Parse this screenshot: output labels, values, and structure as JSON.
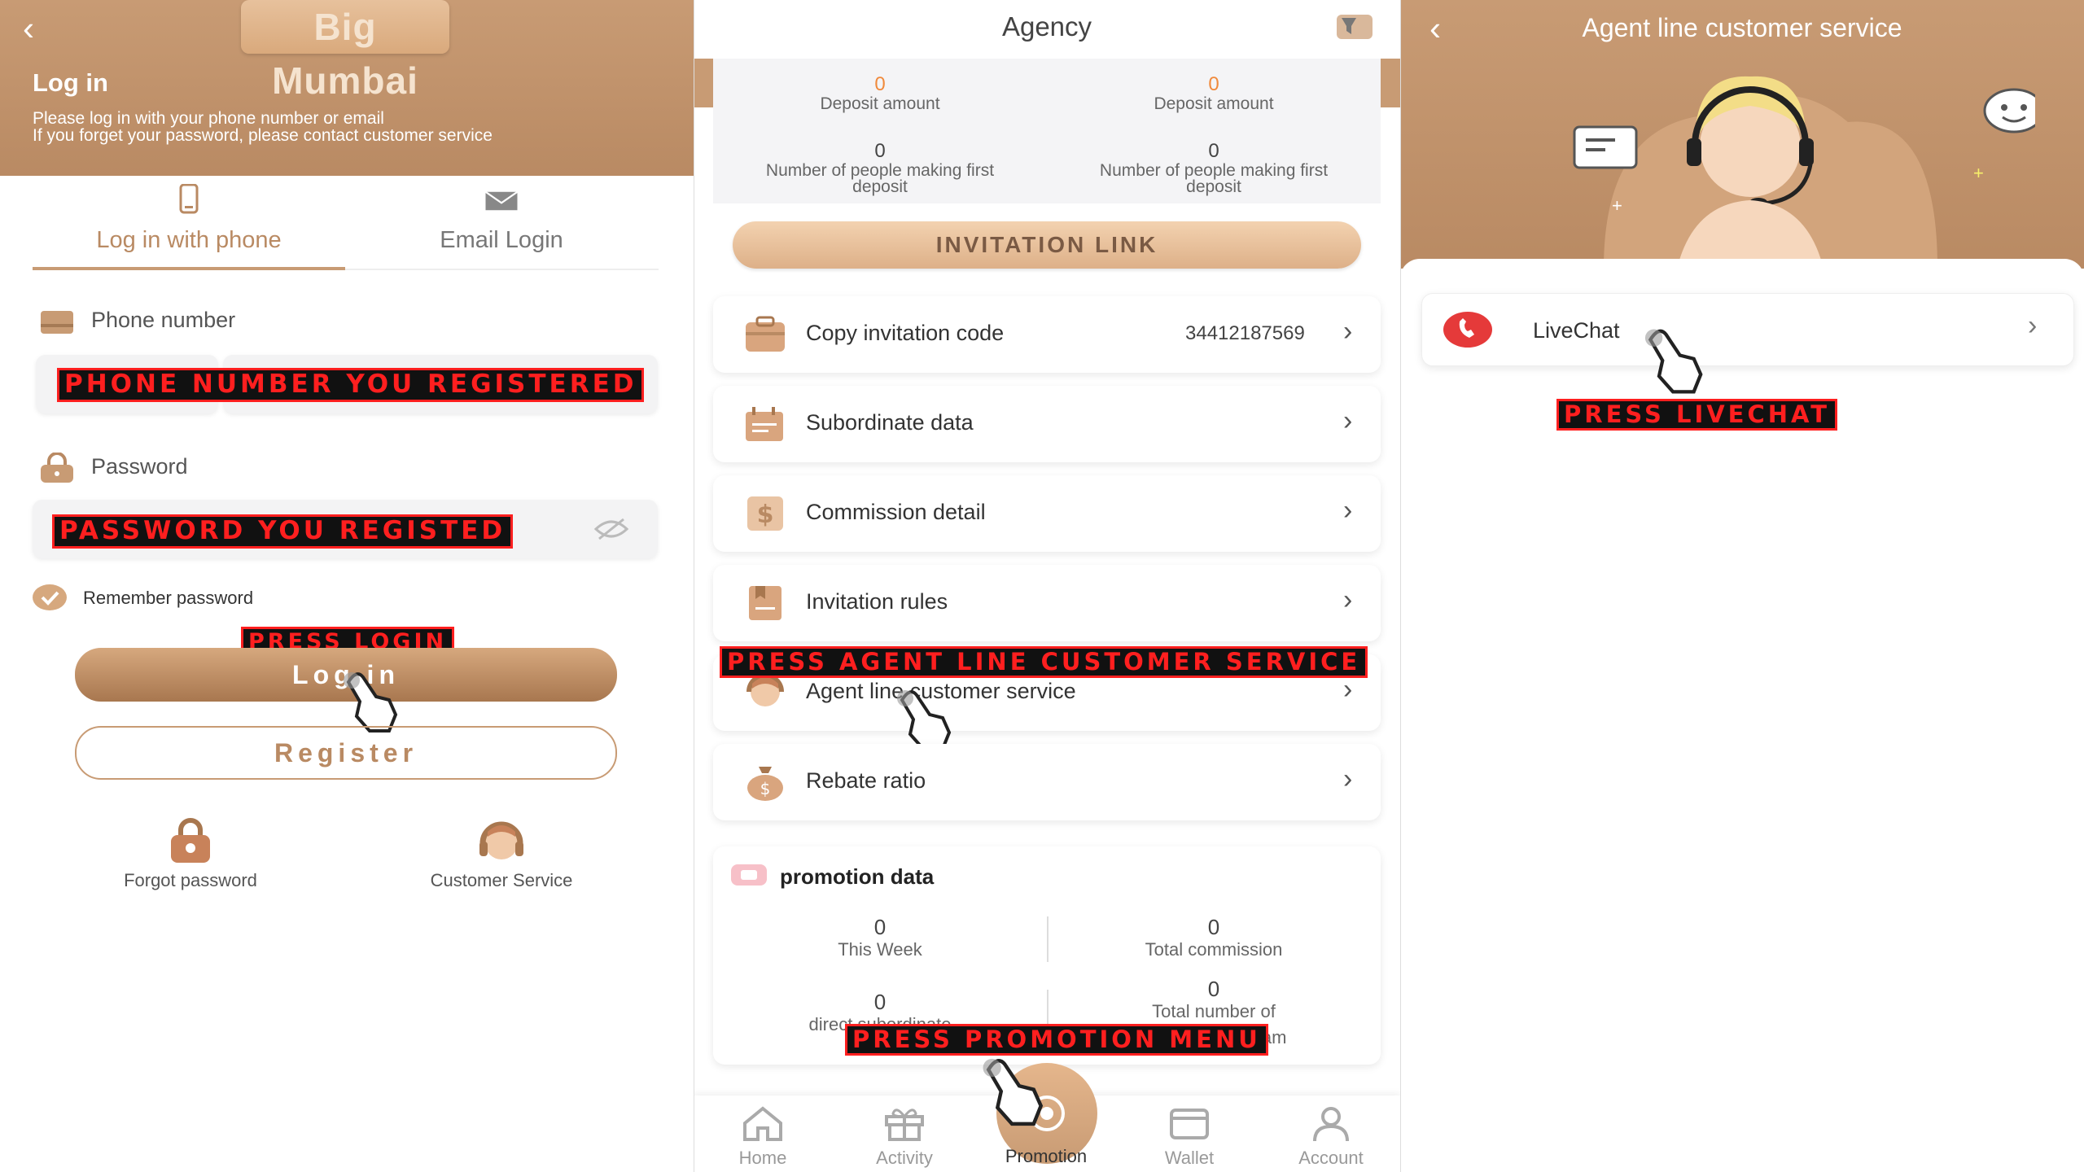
{
  "login": {
    "back_icon": "chevron-left-icon",
    "logo_text": "Big Mumbai",
    "title": "Log in",
    "subtitle_1": "Please log in with your phone number or email",
    "subtitle_2": "If you forget your password, please contact customer service",
    "tab_phone": "Log in with phone",
    "tab_email": "Email Login",
    "phone_label": "Phone number",
    "phone_annotation": "PHONE NUMBER YOU REGISTERED",
    "password_label": "Password",
    "password_annotation": "PASSWORD YOU REGISTED",
    "remember": "Remember password",
    "press_login": "PRESS LOGIN",
    "login_button": "Log in",
    "register_button": "Register",
    "forgot": "Forgot password",
    "customer_service": "Customer Service"
  },
  "agency": {
    "title": "Agency",
    "deposit_left_value": "0",
    "deposit_left_label": "Deposit amount",
    "deposit_right_value": "0",
    "deposit_right_label": "Deposit amount",
    "first_left_value": "0",
    "first_left_label_1": "Number of people making first",
    "first_left_label_2": "deposit",
    "first_right_value": "0",
    "first_right_label_1": "Number of people making first",
    "first_right_label_2": "deposit",
    "invitation_link": "INVITATION LINK",
    "rows": [
      {
        "label": "Copy invitation code",
        "value": "34412187569"
      },
      {
        "label": "Subordinate data",
        "value": ""
      },
      {
        "label": "Commission detail",
        "value": ""
      },
      {
        "label": "Invitation rules",
        "value": ""
      },
      {
        "label": "Agent line customer service",
        "value": ""
      },
      {
        "label": "Rebate ratio",
        "value": ""
      }
    ],
    "agent_annotation": "PRESS AGENT LINE CUSTOMER SERVICE",
    "promo_title": "promotion data",
    "this_week_value": "0",
    "this_week_label": "This Week",
    "total_commission_value": "0",
    "total_commission_label": "Total commission",
    "direct_value": "0",
    "direct_label": "direct subordinate",
    "total_team_value": "0",
    "total_team_label_1": "Total number of",
    "total_team_label_2": "team",
    "promo_annotation": "PRESS PROMOTION MENU",
    "nav": [
      {
        "label": "Home",
        "icon": "home-icon"
      },
      {
        "label": "Activity",
        "icon": "gift-icon"
      },
      {
        "label": "Promotion",
        "icon": "promotion-icon"
      },
      {
        "label": "Wallet",
        "icon": "wallet-icon"
      },
      {
        "label": "Account",
        "icon": "account-icon"
      }
    ]
  },
  "service": {
    "title": "Agent line customer service",
    "livechat": "LiveChat",
    "annotation": "PRESS LIVECHAT"
  },
  "colors": {
    "brand": "#c89b74",
    "accent_orange": "#f08a3c",
    "annotation_red": "#ff1f1f"
  }
}
